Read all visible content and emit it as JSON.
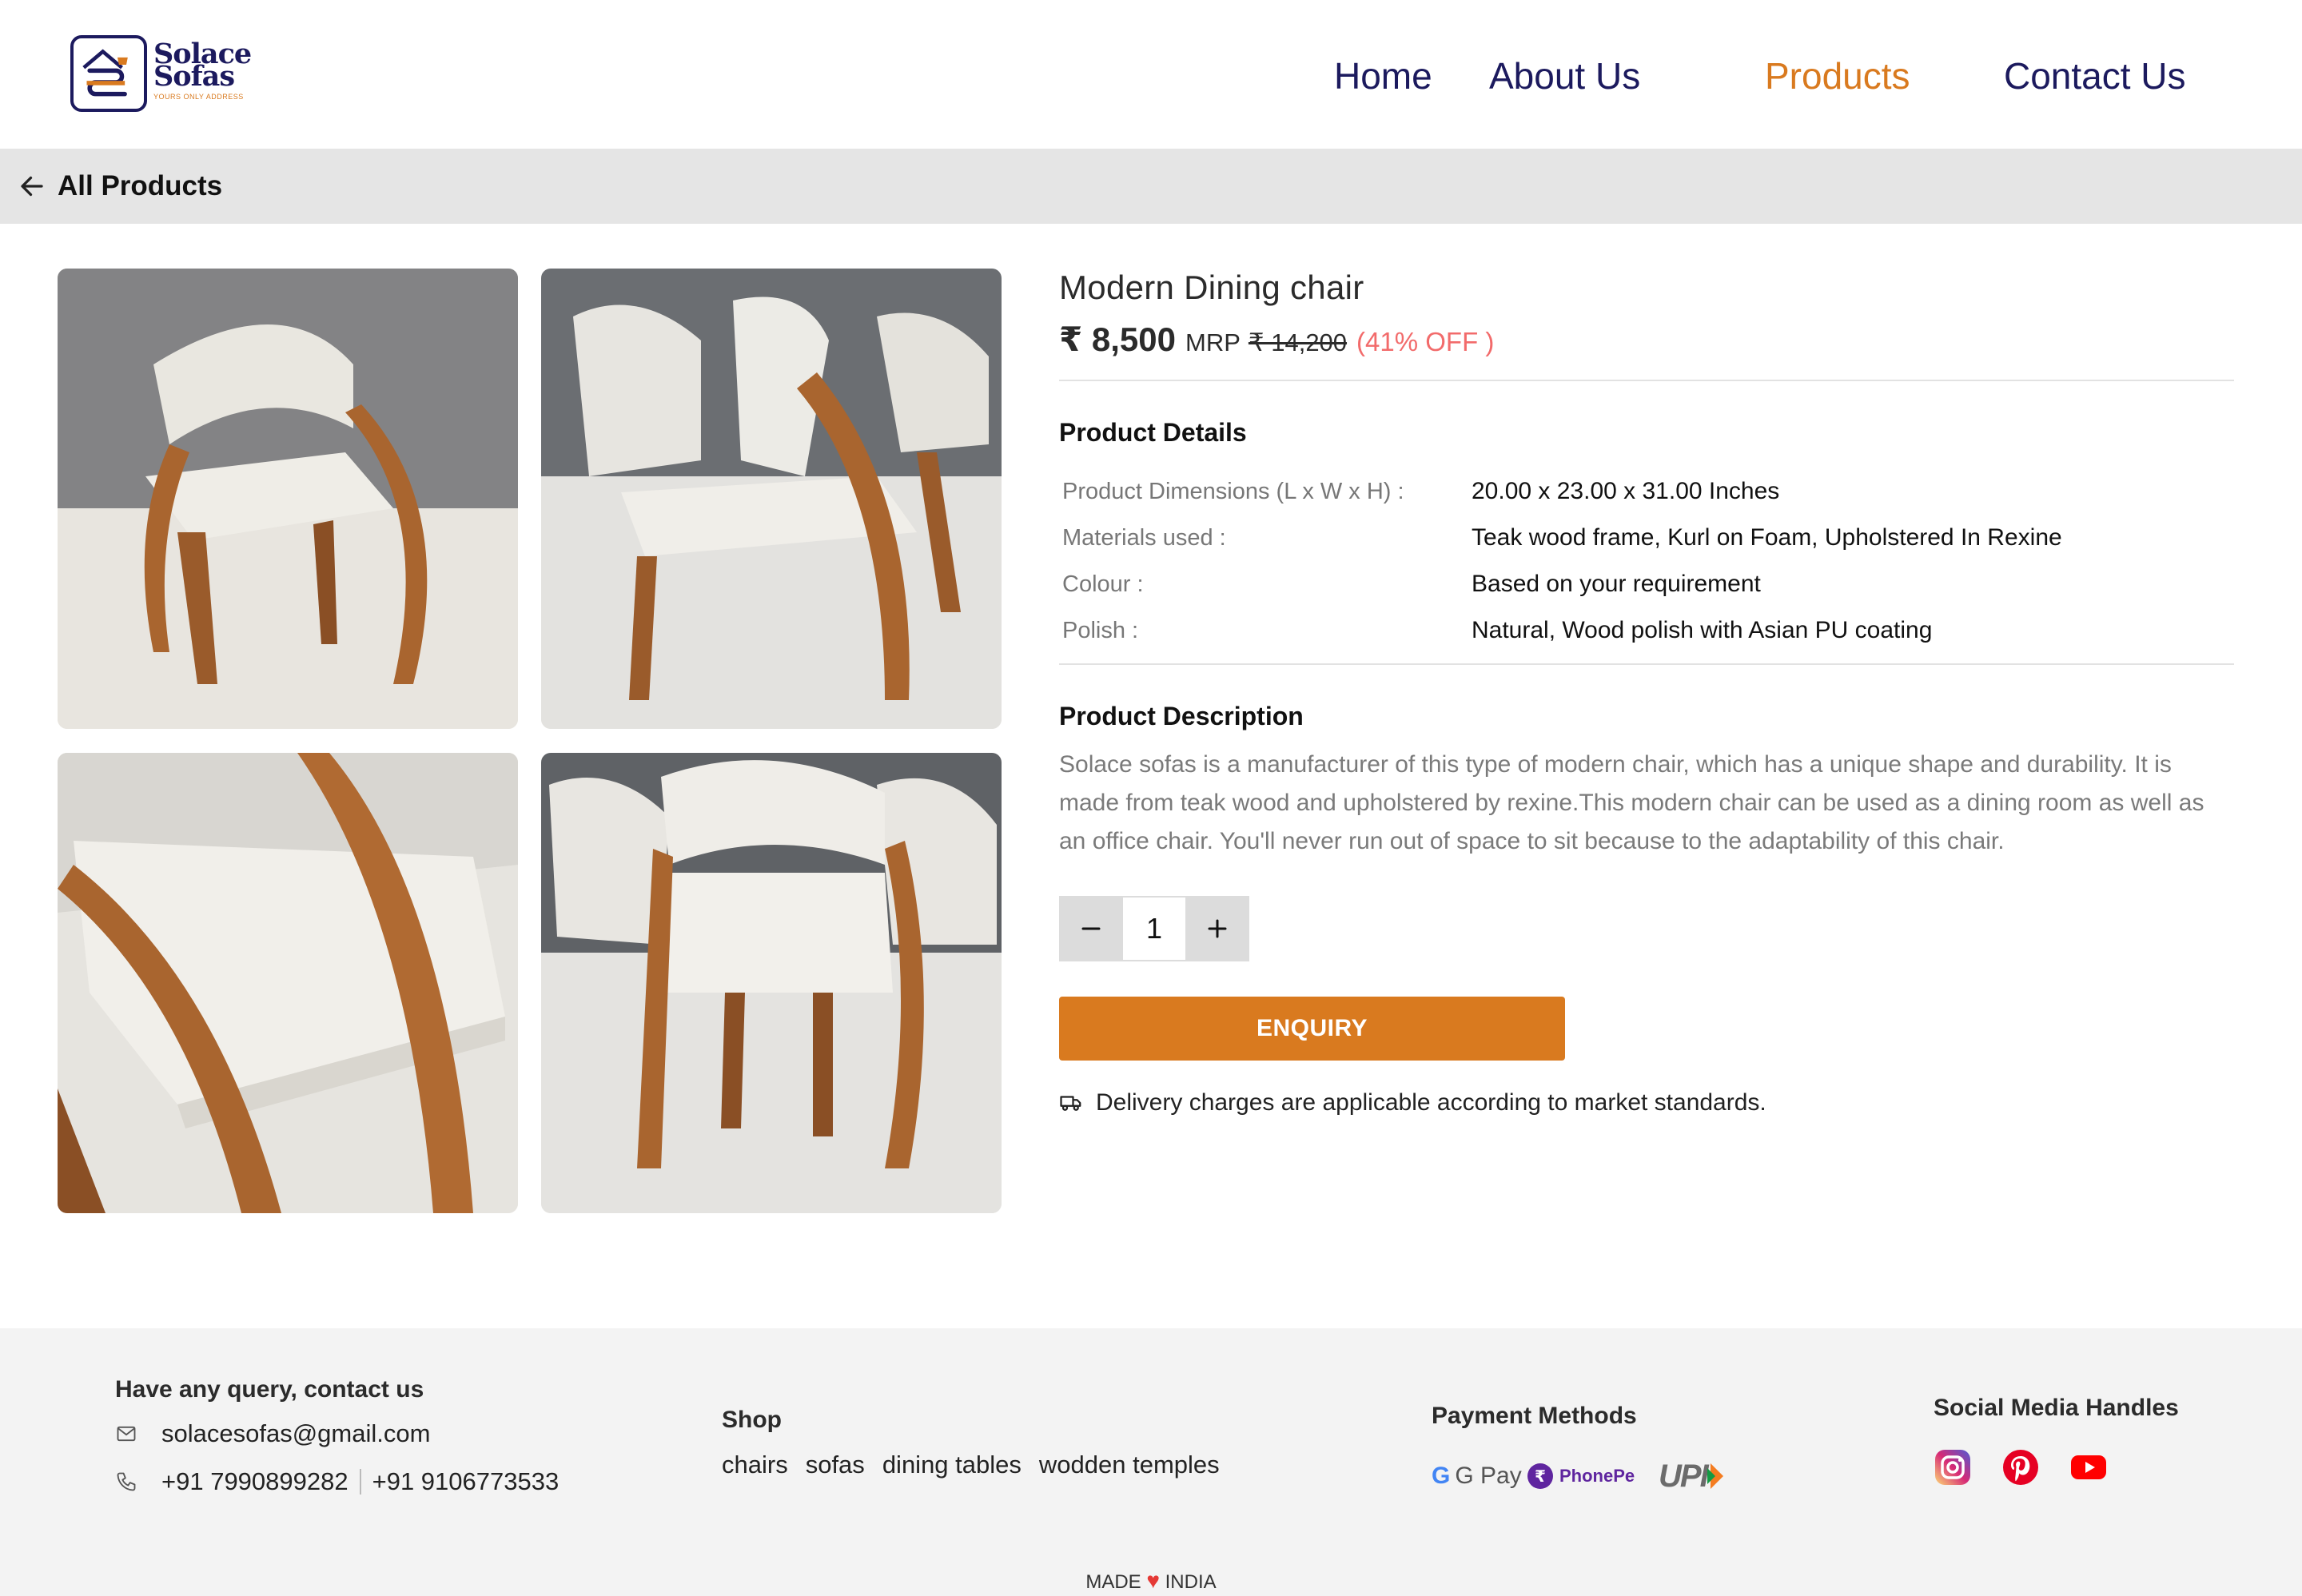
{
  "brand": {
    "name_line1": "Solace",
    "name_line2": "Sofas",
    "tagline": "YOURS ONLY ADDRESS"
  },
  "nav": {
    "items": [
      {
        "label": "Home"
      },
      {
        "label": "About Us"
      },
      {
        "label": "Products",
        "active": true
      },
      {
        "label": "Contact Us"
      }
    ]
  },
  "breadcrumb": {
    "back_label": "All Products"
  },
  "product": {
    "title": "Modern Dining chair",
    "price": "₹ 8,500",
    "mrp_label": "MRP",
    "old_price": "₹ 14,200",
    "discount": "(41% OFF )",
    "details_heading": "Product Details",
    "details": [
      {
        "label": "Product Dimensions (L x W x H) :",
        "value": "20.00 x 23.00 x 31.00 Inches"
      },
      {
        "label": "Materials used :",
        "value": "Teak wood frame, Kurl on Foam, Upholstered In Rexine"
      },
      {
        "label": "Colour :",
        "value": "Based on your requirement"
      },
      {
        "label": "Polish :",
        "value": "Natural, Wood polish with Asian PU coating"
      }
    ],
    "description_heading": "Product Description",
    "description": "Solace sofas is a manufacturer of this type of modern chair, which has a unique shape and durability. It is made from teak wood and upholstered by rexine.This modern chair can be used as a dining room as well as an office chair. You'll never run out of space to sit because to the adaptability of this chair.",
    "quantity": "1",
    "enquiry_label": "ENQUIRY",
    "delivery_note": "Delivery charges are applicable according to market standards."
  },
  "footer": {
    "contact_heading": "Have any query, contact us",
    "email": "solacesofas@gmail.com",
    "phone1": "+91 7990899282",
    "phone2": "+91 9106773533",
    "shop_heading": "Shop",
    "shop_links": [
      "chairs",
      "sofas",
      "dining tables",
      "wodden temples"
    ],
    "payment_heading": "Payment Methods",
    "payment_methods": [
      "G Pay",
      "PhonePe",
      "UPI"
    ],
    "social_heading": "Social Media Handles",
    "social_icons": [
      "instagram-icon",
      "pinterest-icon",
      "youtube-icon"
    ],
    "made_left": "MADE",
    "made_right": "INDIA"
  },
  "colors": {
    "accent": "#d97a1f",
    "navy": "#1c1a5e",
    "discount": "#f26b6b"
  }
}
